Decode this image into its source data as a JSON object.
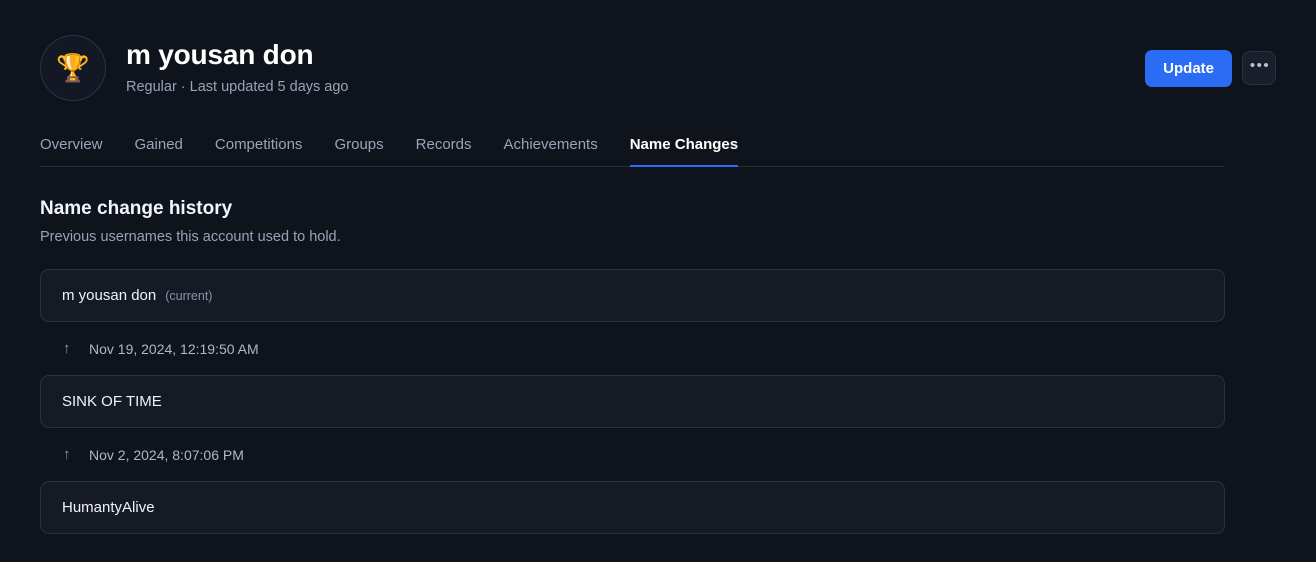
{
  "header": {
    "avatar_icon": "trophy-icon",
    "avatar_glyph": "🏆",
    "title": "m yousan don",
    "subtitle": "Regular · Last updated 5 days ago",
    "update_label": "Update",
    "more_label": "•••"
  },
  "tabs": [
    {
      "label": "Overview",
      "active": false
    },
    {
      "label": "Gained",
      "active": false
    },
    {
      "label": "Competitions",
      "active": false
    },
    {
      "label": "Groups",
      "active": false
    },
    {
      "label": "Records",
      "active": false
    },
    {
      "label": "Achievements",
      "active": false
    },
    {
      "label": "Name Changes",
      "active": true
    }
  ],
  "section": {
    "title": "Name change history",
    "subtitle": "Previous usernames this account used to hold."
  },
  "name_changes": [
    {
      "name": "m yousan don",
      "current_label": "(current)"
    },
    {
      "name": "SINK OF TIME",
      "current_label": ""
    },
    {
      "name": "HumantyAlive",
      "current_label": ""
    }
  ],
  "transitions": [
    {
      "arrow": "↑",
      "date": "Nov 19, 2024, 12:19:50 AM"
    },
    {
      "arrow": "↑",
      "date": "Nov 2, 2024, 8:07:06 PM"
    }
  ],
  "colors": {
    "page_background": "#0f131c",
    "card_background": "#151a25",
    "card_border": "#2a3140",
    "accent": "#2a6df4",
    "text_primary": "#f0f3f9",
    "text_muted": "#98a2b8"
  }
}
